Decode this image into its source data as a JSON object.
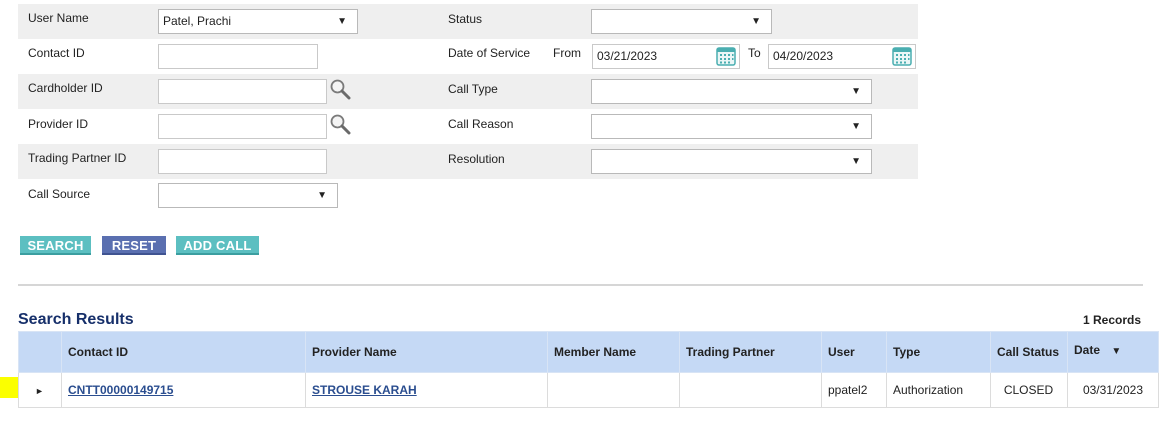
{
  "form": {
    "user_name": {
      "label": "User Name",
      "value": "Patel, Prachi"
    },
    "contact_id": {
      "label": "Contact ID",
      "value": ""
    },
    "cardholder_id": {
      "label": "Cardholder ID",
      "value": ""
    },
    "provider_id": {
      "label": "Provider ID",
      "value": ""
    },
    "trading_partner_id": {
      "label": "Trading Partner ID",
      "value": ""
    },
    "call_source": {
      "label": "Call Source",
      "value": ""
    },
    "status": {
      "label": "Status",
      "value": ""
    },
    "date_of_service": {
      "label": "Date of Service",
      "from_label": "From",
      "from_value": "03/21/2023",
      "to_label": "To",
      "to_value": "04/20/2023"
    },
    "call_type": {
      "label": "Call Type",
      "value": ""
    },
    "call_reason": {
      "label": "Call Reason",
      "value": ""
    },
    "resolution": {
      "label": "Resolution",
      "value": ""
    }
  },
  "buttons": {
    "search": "SEARCH",
    "reset": "RESET",
    "add_call": "ADD CALL"
  },
  "results": {
    "title": "Search Results",
    "records": "1 Records",
    "columns": [
      "Contact ID",
      "Provider Name",
      "Member Name",
      "Trading Partner",
      "User",
      "Type",
      "Call Status",
      "Date"
    ],
    "sort_indicator": "▼",
    "rows": [
      {
        "contact_id": "CNTT00000149715",
        "provider_name": "STROUSE KARAH",
        "member_name": "",
        "trading_partner": "",
        "user": "ppatel2",
        "type": "Authorization",
        "call_status": "CLOSED",
        "date": "03/31/2023"
      }
    ]
  },
  "icons": {
    "dropdown": "chevron-down-icon",
    "lookup": "magnifier-icon",
    "calendar": "calendar-icon",
    "expand": "triangle-right-icon"
  },
  "colors": {
    "header_bg": "#c5d9f5",
    "title": "#162f6a",
    "link": "#2a4d8f",
    "teal_button": "#5cbfc1",
    "blue_button": "#5a6fb0",
    "highlight": "#fbff00"
  }
}
